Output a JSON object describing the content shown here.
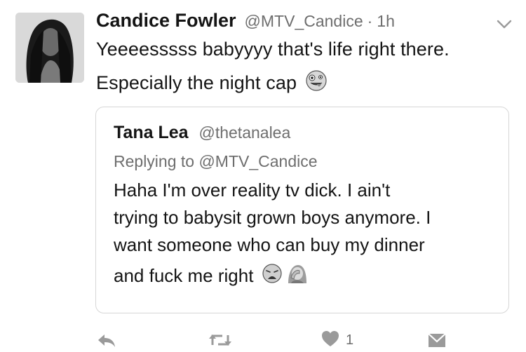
{
  "tweet": {
    "author_name": "Candice Fowler",
    "author_handle": "@MTV_Candice",
    "separator": "·",
    "time": "1h",
    "text_lines": [
      "Yeeeesssss babyyyy that's life right there.",
      "Especially  the night cap"
    ],
    "emoji": "zany-face-icon"
  },
  "quoted_tweet": {
    "author_name": "Tana Lea",
    "author_handle": "@thetanalea",
    "replying_to": "Replying to @MTV_Candice",
    "text_lines": [
      "Haha I'm over reality tv dick. I ain't",
      "trying to babysit grown boys anymore. I",
      "want someone who can buy my dinner",
      "and fuck me right"
    ],
    "emojis": [
      "weary-face-icon",
      "facepalm-icon"
    ]
  },
  "actions": {
    "like_count": "1",
    "icons": [
      "reply-icon",
      "retweet-icon",
      "like-icon",
      "direct-message-icon"
    ]
  },
  "colors": {
    "text": "#141414",
    "secondary": "#6e6e6e",
    "border": "#d6d6d6",
    "icon": "#9a9a9a"
  }
}
